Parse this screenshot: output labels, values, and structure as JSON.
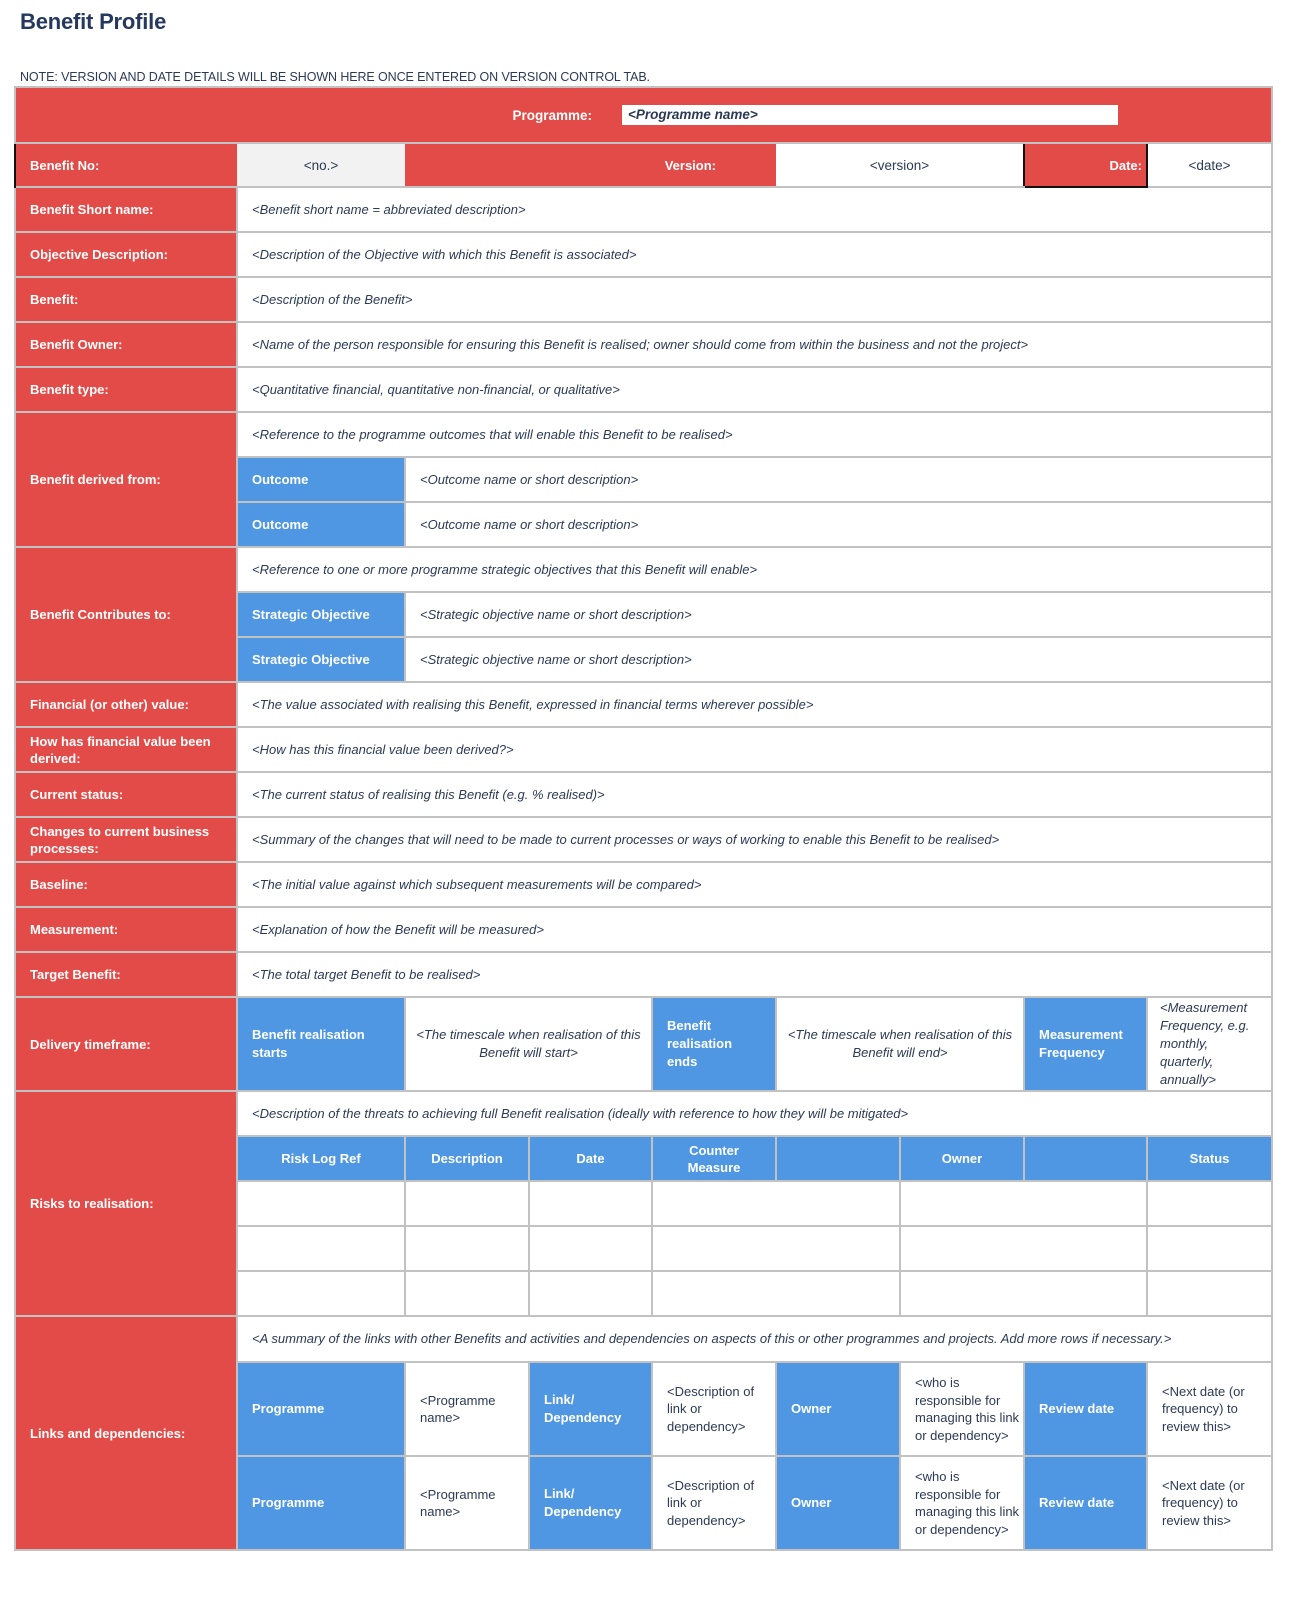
{
  "page": {
    "title": "Benefit Profile",
    "note": "NOTE: VERSION AND DATE DETAILS WILL BE SHOWN HERE ONCE ENTERED ON VERSION CONTROL TAB."
  },
  "colors": {
    "label_red": "#e24b48",
    "header_blue": "#4f97e3",
    "title_navy": "#25395e",
    "grid_gray": "#c2c2c2"
  },
  "header": {
    "programme_label": "Programme:",
    "programme_value": "<Programme name>",
    "benefit_no_label": "Benefit No:",
    "benefit_no_value": "<no.>",
    "version_label": "Version:",
    "version_value": "<version>",
    "date_label": "Date:",
    "date_value": "<date>"
  },
  "rows": {
    "short_name": {
      "label": "Benefit Short name:",
      "value": "<Benefit short name = abbreviated description>"
    },
    "objective": {
      "label": "Objective Description:",
      "value": "<Description of the Objective with which this Benefit is associated>"
    },
    "benefit": {
      "label": "Benefit:",
      "value": "<Description of the Benefit>"
    },
    "owner": {
      "label": "Benefit Owner:",
      "value": "<Name of the person responsible for ensuring this Benefit is realised; owner should come from within the business and not the project>"
    },
    "type": {
      "label": "Benefit type:",
      "value": "<Quantitative financial, quantitative non-financial, or qualitative>"
    },
    "derived_from": {
      "label": "Benefit derived from:",
      "value": "<Reference to the programme outcomes that will enable this Benefit to be realised>",
      "items": [
        {
          "label": "Outcome",
          "value": "<Outcome name or short description>"
        },
        {
          "label": "Outcome",
          "value": "<Outcome name or short description>"
        }
      ]
    },
    "contributes_to": {
      "label": "Benefit Contributes to:",
      "value": "<Reference to one or more programme strategic objectives that this Benefit will enable>",
      "items": [
        {
          "label": "Strategic Objective",
          "value": "<Strategic objective name or short description>"
        },
        {
          "label": "Strategic Objective",
          "value": "<Strategic objective name or short description>"
        }
      ]
    },
    "financial_value": {
      "label": "Financial (or other) value:",
      "value": "<The value associated with realising this Benefit, expressed in financial terms wherever possible>"
    },
    "value_derived": {
      "label": "How has financial value been derived:",
      "value": "<How has this financial value been derived?>"
    },
    "current_status": {
      "label": "Current status:",
      "value": "<The current status of realising this Benefit (e.g. % realised)>"
    },
    "changes": {
      "label": "Changes to current business processes:",
      "value": "<Summary of the changes that will need to be made to current processes or ways of working to enable this Benefit to be realised>"
    },
    "baseline": {
      "label": "Baseline:",
      "value": "<The initial value against which subsequent measurements will be compared>"
    },
    "measurement": {
      "label": "Measurement:",
      "value": "<Explanation of how the Benefit will be measured>"
    },
    "target": {
      "label": "Target Benefit:",
      "value": "<The total target Benefit to be realised>"
    },
    "timeframe": {
      "label": "Delivery timeframe:",
      "start_label": "Benefit realisation starts",
      "start_value": "<The timescale when realisation of this Benefit will start>",
      "end_label": "Benefit realisation ends",
      "end_value": "<The timescale when realisation of this Benefit will end>",
      "freq_label": "Measurement Frequency",
      "freq_value": "<Measurement Frequency, e.g. monthly, quarterly, annually>"
    },
    "risks": {
      "label": "Risks to realisation:",
      "value": "<Description of the threats to achieving full Benefit realisation (ideally with reference to how they will be mitigated>",
      "columns": [
        "Risk Log Ref",
        "Description",
        "Date",
        "Counter Measure",
        "",
        "Owner",
        "",
        "Status"
      ],
      "rows": [
        [
          "",
          "",
          "",
          "",
          "",
          ""
        ],
        [
          "",
          "",
          "",
          "",
          "",
          ""
        ],
        [
          "",
          "",
          "",
          "",
          "",
          ""
        ]
      ]
    },
    "links": {
      "label": "Links and dependencies:",
      "value": "<A summary of the links with other Benefits and activities and dependencies on aspects of this or other programmes and projects.  Add more rows if necessary.>",
      "rows": [
        {
          "programme_label": "Programme",
          "programme_value": "<Programme name>",
          "link_label": "Link/ Dependency",
          "link_value": "<Description of link or dependency>",
          "owner_label": "Owner",
          "owner_value": "<who is responsible for managing this link or dependency>",
          "review_label": "Review date",
          "review_value": "<Next date (or frequency) to review this>"
        },
        {
          "programme_label": "Programme",
          "programme_value": "<Programme name>",
          "link_label": "Link/ Dependency",
          "link_value": "<Description of link or dependency>",
          "owner_label": "Owner",
          "owner_value": "<who is responsible for managing this link or dependency>",
          "review_label": "Review date",
          "review_value": "<Next date (or frequency) to review this>"
        }
      ]
    }
  }
}
